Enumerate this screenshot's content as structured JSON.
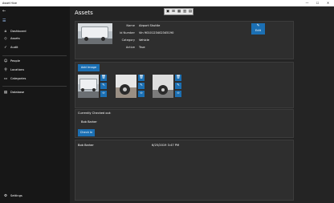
{
  "window": {
    "title": "Asset Hive",
    "minimize": "—",
    "maximize": "☐",
    "close": "✕"
  },
  "sidebar": {
    "back": "←",
    "hamburger": "☰",
    "items": [
      {
        "label": "Dashboard",
        "icon": "⌂"
      },
      {
        "label": "Assets",
        "icon": "◇"
      },
      {
        "label": "Audit",
        "icon": "✓"
      },
      {
        "label": "People",
        "icon": "☺"
      },
      {
        "label": "Locations",
        "icon": "⚲"
      },
      {
        "label": "Categories",
        "icon": "▭"
      },
      {
        "label": "Database",
        "icon": "▤"
      }
    ],
    "settings": {
      "label": "Settings",
      "icon": "⚙"
    }
  },
  "page": {
    "title": "Assets"
  },
  "toolbar": {
    "icons": [
      "▣",
      "⊞",
      "▦",
      "▥",
      "▤"
    ]
  },
  "asset": {
    "fields": [
      {
        "label": "Name",
        "value": "Airport Shuttle"
      },
      {
        "label": "Id Number",
        "value": "Vin 9010123402345190"
      },
      {
        "label": "Category",
        "value": "Vehicle"
      },
      {
        "label": "Active",
        "value": "True"
      }
    ],
    "edit_label": "Edit",
    "edit_icon": "✎"
  },
  "images": {
    "add_label": "Add Image",
    "delete_icon": "🗑",
    "edit_icon": "✎",
    "count": 3
  },
  "checkout": {
    "header": "Currently Checked out:",
    "person": "Bob Barker",
    "checkin_label": "Check In"
  },
  "history": [
    {
      "person": "Bob Barker",
      "date": "6/25/2019 3:47 PM"
    }
  ]
}
